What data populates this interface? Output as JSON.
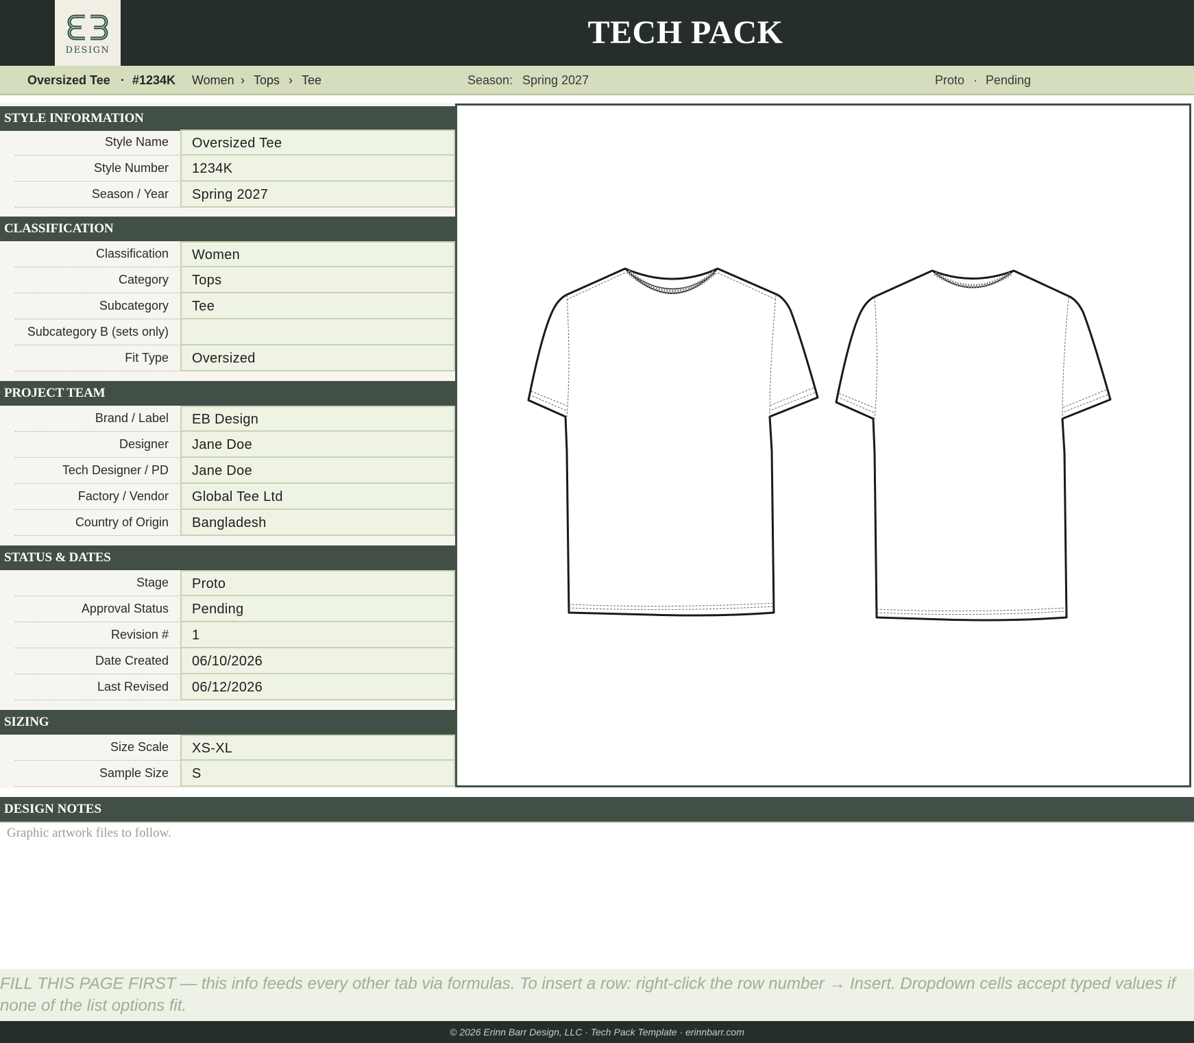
{
  "header": {
    "title": "TECH PACK",
    "logo_text": "DESIGN"
  },
  "summary": {
    "style_name": "Oversized Tee",
    "dot": "·",
    "style_number": "#1234K",
    "breadcrumb": [
      "Women",
      "Tops",
      "Tee"
    ],
    "separator": "›",
    "season_label": "Season:",
    "season_value": "Spring 2027",
    "stage": "Proto",
    "status": "Pending"
  },
  "sections": {
    "style_information": {
      "title": "STYLE INFORMATION",
      "rows": [
        {
          "label": "Style Name",
          "value": "Oversized Tee"
        },
        {
          "label": "Style Number",
          "value": "1234K"
        },
        {
          "label": "Season / Year",
          "value": "Spring 2027"
        }
      ]
    },
    "classification": {
      "title": "CLASSIFICATION",
      "rows": [
        {
          "label": "Classification",
          "value": "Women"
        },
        {
          "label": "Category",
          "value": "Tops"
        },
        {
          "label": "Subcategory",
          "value": "Tee"
        },
        {
          "label": "Subcategory B (sets only)",
          "value": ""
        },
        {
          "label": "Fit Type",
          "value": "Oversized"
        }
      ]
    },
    "project_team": {
      "title": "PROJECT TEAM",
      "rows": [
        {
          "label": "Brand / Label",
          "value": "EB Design"
        },
        {
          "label": "Designer",
          "value": "Jane Doe"
        },
        {
          "label": "Tech Designer / PD",
          "value": "Jane Doe"
        },
        {
          "label": "Factory / Vendor",
          "value": "Global Tee Ltd"
        },
        {
          "label": "Country of Origin",
          "value": "Bangladesh"
        }
      ]
    },
    "status_dates": {
      "title": "STATUS & DATES",
      "rows": [
        {
          "label": "Stage",
          "value": "Proto"
        },
        {
          "label": "Approval Status",
          "value": "Pending"
        },
        {
          "label": "Revision #",
          "value": "1"
        },
        {
          "label": "Date Created",
          "value": "06/10/2026"
        },
        {
          "label": "Last Revised",
          "value": "06/12/2026"
        }
      ]
    },
    "sizing": {
      "title": "SIZING",
      "rows": [
        {
          "label": "Size Scale",
          "value": "XS-XL"
        },
        {
          "label": "Sample Size",
          "value": "S"
        }
      ]
    }
  },
  "design_notes": {
    "title": "DESIGN NOTES",
    "text": "Graphic artwork files to follow."
  },
  "instructions": "FILL THIS PAGE FIRST — this info feeds every other tab via formulas. To insert a row: right-click the row number → Insert. Dropdown cells accept typed values if none of the list options fit.",
  "footer": "© 2026 Erinn Barr Design, LLC  ·  Tech Pack Template  ·  erinnbarr.com",
  "colors": {
    "header_bg": "#262e2b",
    "section_bg": "#414f47",
    "summary_bg": "#d5ddbd",
    "field_bg": "#eef3e4"
  }
}
